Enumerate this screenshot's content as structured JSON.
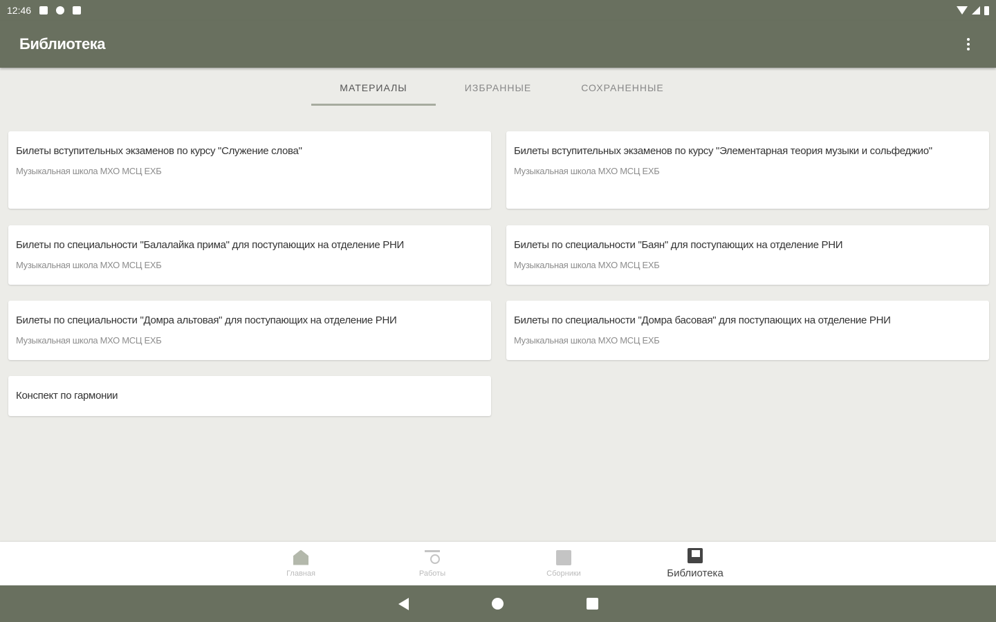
{
  "status_bar": {
    "time": "12:46",
    "icons": [
      "notification-icon",
      "sync-icon",
      "sd-card-icon",
      "wifi-icon",
      "signal-icon",
      "battery-icon"
    ]
  },
  "app_bar": {
    "title": "Библиотека",
    "menu_icon": "more-vert-icon"
  },
  "tabs": [
    {
      "label": "МАТЕРИАЛЫ",
      "active": true
    },
    {
      "label": "ИЗБРАННЫЕ",
      "active": false
    },
    {
      "label": "СОХРАНЕННЫЕ",
      "active": false
    }
  ],
  "cards": [
    {
      "title": "Билеты вступительных экзаменов по курсу \"Служение слова\"",
      "subtitle": "Музыкальная школа МХО МСЦ ЕХБ"
    },
    {
      "title": "Билеты вступительных экзаменов по курсу \"Элементарная теория музыки и сольфеджио\"",
      "subtitle": "Музыкальная школа МХО МСЦ ЕХБ"
    },
    {
      "title": "Билеты по специальности \"Балалайка прима\" для поступающих на отделение РНИ",
      "subtitle": "Музыкальная школа МХО МСЦ ЕХБ"
    },
    {
      "title": "Билеты по специальности \"Баян\" для поступающих на отделение РНИ",
      "subtitle": "Музыкальная школа МХО МСЦ ЕХБ"
    },
    {
      "title": "Билеты по специальности \"Домра альтовая\" для поступающих на отделение РНИ",
      "subtitle": "Музыкальная школа МХО МСЦ ЕХБ"
    },
    {
      "title": "Билеты по специальности \"Домра басовая\" для поступающих на отделение РНИ",
      "subtitle": "Музыкальная школа МХО МСЦ ЕХБ"
    },
    {
      "title": "Конспект по гармонии",
      "subtitle": ""
    }
  ],
  "bottom_nav": [
    {
      "label": "Главная",
      "icon": "home-icon",
      "active": false
    },
    {
      "label": "Работы",
      "icon": "works-search-icon",
      "active": false
    },
    {
      "label": "Сборники",
      "icon": "collection-icon",
      "active": false
    },
    {
      "label": "Библиотека",
      "icon": "library-icon",
      "active": true
    }
  ],
  "colors": {
    "primary": "#69705f",
    "background": "#ecece8",
    "card": "#ffffff"
  }
}
